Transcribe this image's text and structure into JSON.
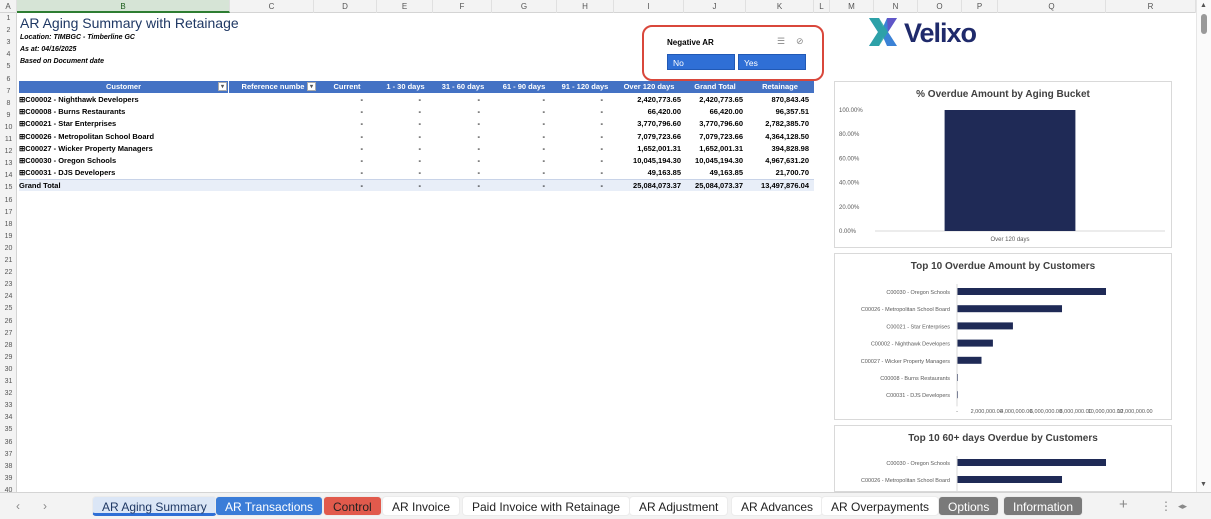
{
  "columns": [
    "A",
    "B",
    "C",
    "D",
    "E",
    "F",
    "G",
    "H",
    "I",
    "J",
    "K",
    "L",
    "M",
    "N",
    "O",
    "P",
    "Q",
    "R"
  ],
  "rows": [
    "1",
    "2",
    "3",
    "4",
    "5",
    "6",
    "7",
    "8",
    "9",
    "10",
    "11",
    "12",
    "13",
    "14",
    "15",
    "16",
    "17",
    "18",
    "19",
    "20",
    "21",
    "22",
    "23",
    "24",
    "25",
    "26",
    "27",
    "28",
    "29",
    "30",
    "31",
    "32",
    "33",
    "34",
    "35",
    "36",
    "37",
    "38",
    "39",
    "40"
  ],
  "report": {
    "title": "AR Aging Summary with Retainage",
    "location": "Location: TIMBGC - Timberline GC",
    "as_at": "As at: 04/16/2025",
    "basis": "Based on Document date"
  },
  "pivot": {
    "headers": [
      "Customer",
      "Reference numbe",
      "Current",
      "1 - 30 days",
      "31 - 60 days",
      "61 - 90 days",
      "91 - 120 days",
      "Over 120 days",
      "Grand Total",
      "Retainage"
    ],
    "rows": [
      {
        "customer": "⊞C00002 - Nighthawk Developers",
        "current": "-",
        "d1_30": "-",
        "d31_60": "-",
        "d61_90": "-",
        "d91_120": "-",
        "over120": "2,420,773.65",
        "total": "2,420,773.65",
        "retainage": "870,843.45"
      },
      {
        "customer": "⊞C00008 - Burns Restaurants",
        "current": "-",
        "d1_30": "-",
        "d31_60": "-",
        "d61_90": "-",
        "d91_120": "-",
        "over120": "66,420.00",
        "total": "66,420.00",
        "retainage": "96,357.51"
      },
      {
        "customer": "⊞C00021 - Star Enterprises",
        "current": "-",
        "d1_30": "-",
        "d31_60": "-",
        "d61_90": "-",
        "d91_120": "-",
        "over120": "3,770,796.60",
        "total": "3,770,796.60",
        "retainage": "2,782,385.70"
      },
      {
        "customer": "⊞C00026 - Metropolitan School Board",
        "current": "-",
        "d1_30": "-",
        "d31_60": "-",
        "d61_90": "-",
        "d91_120": "-",
        "over120": "7,079,723.66",
        "total": "7,079,723.66",
        "retainage": "4,364,128.50"
      },
      {
        "customer": "⊞C00027 - Wicker Property Managers",
        "current": "-",
        "d1_30": "-",
        "d31_60": "-",
        "d61_90": "-",
        "d91_120": "-",
        "over120": "1,652,001.31",
        "total": "1,652,001.31",
        "retainage": "394,828.98"
      },
      {
        "customer": "⊞C00030 - Oregon Schools",
        "current": "-",
        "d1_30": "-",
        "d31_60": "-",
        "d61_90": "-",
        "d91_120": "-",
        "over120": "10,045,194.30",
        "total": "10,045,194.30",
        "retainage": "4,967,631.20"
      },
      {
        "customer": "⊞C00031 - DJS Developers",
        "current": "-",
        "d1_30": "-",
        "d31_60": "-",
        "d61_90": "-",
        "d91_120": "-",
        "over120": "49,163.85",
        "total": "49,163.85",
        "retainage": "21,700.70"
      }
    ],
    "grand_total": {
      "customer": "Grand Total",
      "current": "-",
      "d1_30": "-",
      "d31_60": "-",
      "d61_90": "-",
      "d91_120": "-",
      "over120": "25,084,073.37",
      "total": "25,084,073.37",
      "retainage": "13,497,876.04"
    }
  },
  "slicer": {
    "label": "Negative AR",
    "options": [
      "No",
      "Yes"
    ]
  },
  "logo": {
    "text": "Velixo"
  },
  "colors": {
    "accent": "#2f6fd6",
    "pivot_header": "#4472c4",
    "bar": "#1f2a56",
    "slicer_border": "#d9473b"
  },
  "chart_data": [
    {
      "type": "bar",
      "title": "% Overdue Amount by Aging Bucket",
      "categories": [
        "Over 120 days"
      ],
      "values": [
        100
      ],
      "y_ticks": [
        "100.00%",
        "80.00%",
        "60.00%",
        "40.00%",
        "20.00%",
        "0.00%"
      ],
      "ylim": [
        0,
        100
      ]
    },
    {
      "type": "bar",
      "orientation": "horizontal",
      "title": "Top 10 Overdue Amount by Customers",
      "categories": [
        "C00030 - Oregon Schools",
        "C00026 - Metropolitan School Board",
        "C00021 - Star Enterprises",
        "C00002 - Nighthawk Developers",
        "C00027 - Wicker Property Managers",
        "C00008 - Burns Restaurants",
        "C00031 - DJS Developers"
      ],
      "values": [
        10045194.3,
        7079723.66,
        3770796.6,
        2420773.65,
        1652001.31,
        66420.0,
        49163.85
      ],
      "x_ticks": [
        "-",
        "2,000,000.00",
        "4,000,000.00",
        "6,000,000.00",
        "8,000,000.00",
        "10,000,000.00",
        "12,000,000.00"
      ],
      "xlim": [
        0,
        12000000
      ]
    },
    {
      "type": "bar",
      "orientation": "horizontal",
      "title": "Top 10 60+ days Overdue by Customers",
      "categories": [
        "C00030 - Oregon Schools",
        "C00026 - Metropolitan School Board"
      ],
      "values": [
        10045194.3,
        7079723.66
      ],
      "xlim": [
        0,
        12000000
      ]
    }
  ],
  "tabs": [
    {
      "label": "AR Aging Summary",
      "style": "active"
    },
    {
      "label": "AR Transactions",
      "style": "blue"
    },
    {
      "label": "Control",
      "style": "red"
    },
    {
      "label": "AR Invoice",
      "style": "plain"
    },
    {
      "label": "Paid Invoice with Retainage",
      "style": "plain"
    },
    {
      "label": "AR Adjustment",
      "style": "plain"
    },
    {
      "label": "AR Advances",
      "style": "plain"
    },
    {
      "label": "AR Overpayments",
      "style": "plain"
    },
    {
      "label": "Options",
      "style": "gray"
    },
    {
      "label": "Information",
      "style": "gray"
    }
  ],
  "tab_controls": {
    "prev": "‹",
    "next": "›",
    "add": "+",
    "more": "⋮",
    "scroll": "◂▸"
  }
}
